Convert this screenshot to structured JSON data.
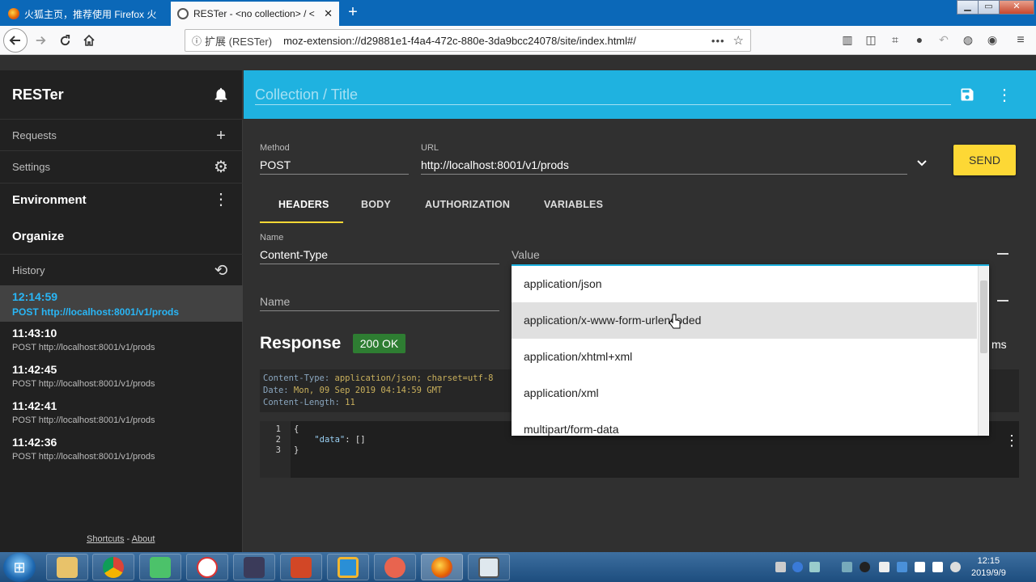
{
  "browser": {
    "tabs": [
      {
        "title": "火狐主页，推荐使用 Firefox 火",
        "active": false
      },
      {
        "title": "RESTer - <no collection> / <",
        "active": true
      }
    ],
    "new_tab": "+",
    "window_controls": [
      "▁",
      "▭",
      "✕"
    ],
    "url_prefix": "扩展 (RESTer)",
    "url": "moz-extension://d29881e1-f4a4-472c-880e-3da9bcc24078/site/index.html#/",
    "url_more": "•••"
  },
  "sidebar": {
    "title": "RESTer",
    "requests": "Requests",
    "settings": "Settings",
    "environment": "Environment",
    "organize": "Organize",
    "history_label": "History",
    "history": [
      {
        "time": "12:14:59",
        "url": "POST http://localhost:8001/v1/prods",
        "active": true
      },
      {
        "time": "11:43:10",
        "url": "POST http://localhost:8001/v1/prods",
        "active": false
      },
      {
        "time": "11:42:45",
        "url": "POST http://localhost:8001/v1/prods",
        "active": false
      },
      {
        "time": "11:42:41",
        "url": "POST http://localhost:8001/v1/prods",
        "active": false
      },
      {
        "time": "11:42:36",
        "url": "POST http://localhost:8001/v1/prods",
        "active": false
      }
    ],
    "footer_shortcuts": "Shortcuts",
    "footer_sep": " - ",
    "footer_about": "About"
  },
  "header": {
    "placeholder": "Collection / Title"
  },
  "request": {
    "method_label": "Method",
    "method": "POST",
    "url_label": "URL",
    "url": "http://localhost:8001/v1/prods",
    "send": "SEND",
    "tabs": [
      "HEADERS",
      "BODY",
      "AUTHORIZATION",
      "VARIABLES"
    ],
    "header_name_label": "Name",
    "header_name": "Content-Type",
    "header_value_placeholder": "Value",
    "new_name_placeholder": "Name"
  },
  "dropdown": {
    "options": [
      "application/json",
      "application/x-www-form-urlencoded",
      "application/xhtml+xml",
      "application/xml",
      "multipart/form-data"
    ],
    "highlighted_index": 1
  },
  "response": {
    "title": "Response",
    "status": "200 OK",
    "time_unit": "ms",
    "headers": [
      {
        "name": "Content-Type:",
        "value": " application/json; charset=utf-8"
      },
      {
        "name": "Date:",
        "value": " Mon, 09 Sep 2019 04:14:59 GMT"
      },
      {
        "name": "Content-Length:",
        "value": " 11"
      }
    ],
    "line_numbers": [
      "1",
      "2",
      "3"
    ],
    "body_line1": "{",
    "body_key": "\"data\"",
    "body_rest": ": []",
    "body_line3": "}"
  },
  "taskbar": {
    "time": "12:15",
    "date": "2019/9/9"
  },
  "colors": {
    "accent": "#1fb2e0",
    "send": "#fdd835",
    "status_ok": "#2e7d32"
  }
}
